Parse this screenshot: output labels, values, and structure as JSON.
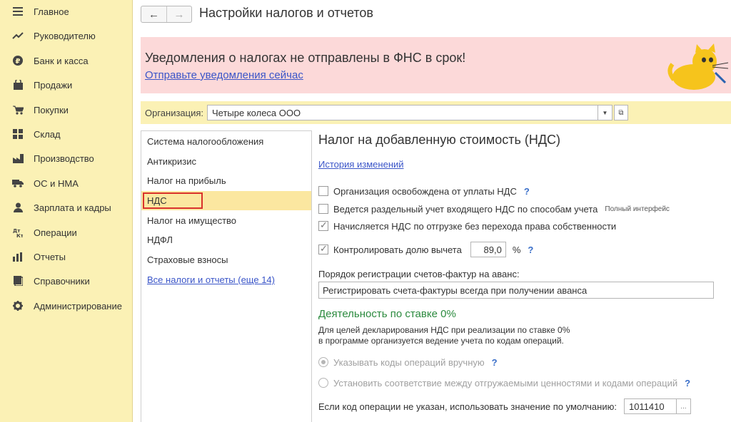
{
  "sidebar": {
    "items": [
      {
        "label": "Главное",
        "icon": "menu-icon"
      },
      {
        "label": "Руководителю",
        "icon": "trend-icon"
      },
      {
        "label": "Банк и касса",
        "icon": "ruble-icon"
      },
      {
        "label": "Продажи",
        "icon": "bag-icon"
      },
      {
        "label": "Покупки",
        "icon": "cart-icon"
      },
      {
        "label": "Склад",
        "icon": "warehouse-icon"
      },
      {
        "label": "Производство",
        "icon": "factory-icon"
      },
      {
        "label": "ОС и НМА",
        "icon": "truck-icon"
      },
      {
        "label": "Зарплата и кадры",
        "icon": "person-icon"
      },
      {
        "label": "Операции",
        "icon": "operations-icon"
      },
      {
        "label": "Отчеты",
        "icon": "bar-chart-icon"
      },
      {
        "label": "Справочники",
        "icon": "book-icon"
      },
      {
        "label": "Администрирование",
        "icon": "gear-icon"
      }
    ]
  },
  "header": {
    "title": "Настройки налогов и отчетов",
    "back_icon": "←",
    "forward_icon": "→"
  },
  "banner": {
    "title": "Уведомления о налогах не отправлены в ФНС в срок!",
    "link": "Отправьте уведомления сейчас"
  },
  "org": {
    "label": "Организация:",
    "value": "Четыре колеса ООО"
  },
  "taxes": {
    "items": [
      "Система налогообложения",
      "Антикризис",
      "Налог на прибыль",
      "НДС",
      "Налог на имущество",
      "НДФЛ",
      "Страховые взносы"
    ],
    "all_link": "Все налоги и отчеты (еще 14)",
    "selected_index": 3
  },
  "vat": {
    "title": "Налог на добавленную стоимость (НДС)",
    "history_link": "История изменений",
    "options": {
      "exempt": {
        "label": "Организация освобождена от уплаты НДС",
        "checked": false,
        "help": "?"
      },
      "separate": {
        "label": "Ведется раздельный учет входящего НДС по способам учета",
        "checked": false,
        "note": "Полный интерфейс"
      },
      "shipment": {
        "label": "Начисляется НДС по отгрузке без перехода права собственности",
        "checked": true
      },
      "control": {
        "label": "Контролировать долю вычета",
        "checked": true,
        "value": "89,0",
        "unit": "%",
        "help": "?"
      }
    },
    "invoice_order_label": "Порядок регистрации счетов-фактур на аванс:",
    "invoice_order_value": "Регистрировать счета-фактуры всегда при получении аванса",
    "zero_rate": {
      "title": "Деятельность по ставке 0%",
      "desc1": "Для целей декларирования НДС при реализации по ставке 0%",
      "desc2": "в программе организуется ведение учета по кодам операций.",
      "radio_manual": "Указывать коды операций вручную",
      "radio_match": "Установить соответствие между отгружаемыми ценностями и кодами операций",
      "help": "?",
      "default_label": "Если код операции не указан, использовать значение по умолчанию:",
      "default_value": "1011410",
      "dots": "..."
    }
  },
  "colors": {
    "sidebar_bg": "#fbf1b5",
    "banner_bg": "#fcd9d9",
    "link": "#3a55c8",
    "selection_frame": "#d9322c",
    "green": "#2b8a3e"
  }
}
